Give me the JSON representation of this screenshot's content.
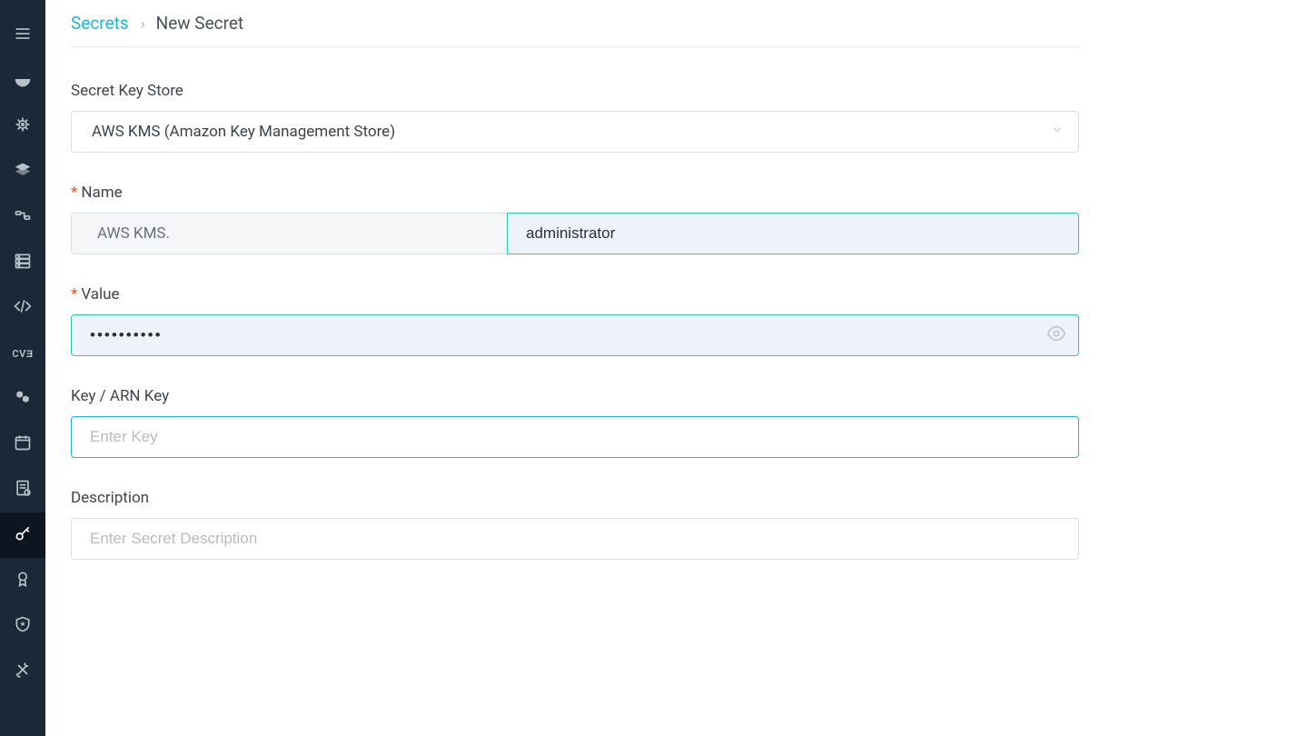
{
  "breadcrumb": {
    "root": "Secrets",
    "current": "New Secret"
  },
  "form": {
    "keyStore": {
      "label": "Secret Key Store",
      "value": "AWS KMS (Amazon Key Management Store)"
    },
    "name": {
      "label": "Name",
      "prefix": "AWS KMS.",
      "value": "administrator"
    },
    "value": {
      "label": "Value",
      "value": "••••••••••"
    },
    "key": {
      "label": "Key  / ARN Key",
      "placeholder": "Enter Key",
      "value": ""
    },
    "description": {
      "label": "Description",
      "placeholder": "Enter Secret Description",
      "value": ""
    }
  },
  "sidebar": {
    "items": [
      {
        "name": "menu"
      },
      {
        "name": "dashboard"
      },
      {
        "name": "wheel"
      },
      {
        "name": "layers"
      },
      {
        "name": "pipeline"
      },
      {
        "name": "servers"
      },
      {
        "name": "code"
      },
      {
        "name": "cve"
      },
      {
        "name": "modules"
      },
      {
        "name": "calendar"
      },
      {
        "name": "report"
      },
      {
        "name": "secrets",
        "active": true
      },
      {
        "name": "badge"
      },
      {
        "name": "security"
      },
      {
        "name": "tools"
      }
    ]
  }
}
